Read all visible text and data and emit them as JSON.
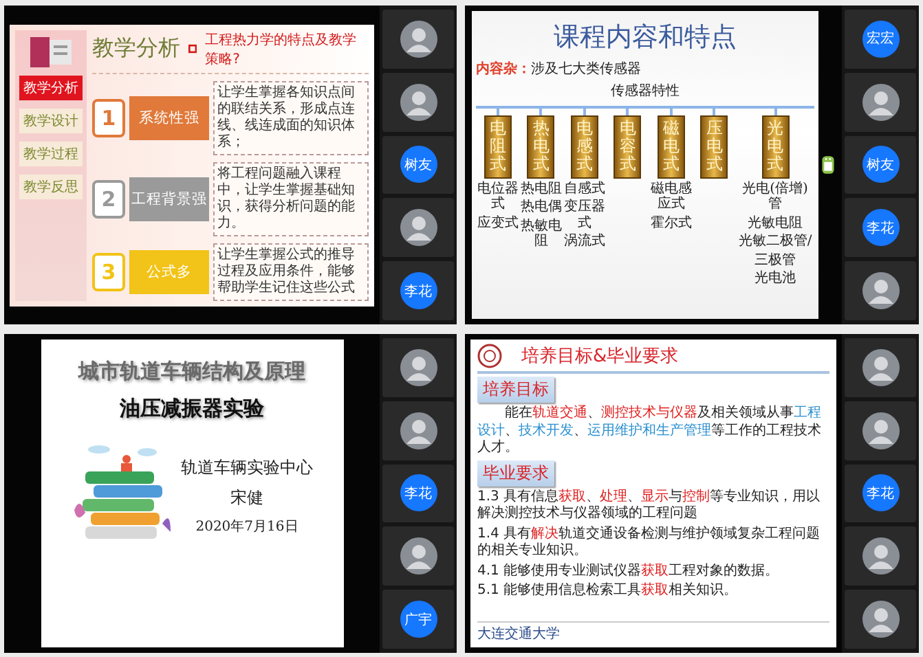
{
  "panels": [
    {
      "kind": "analysis",
      "slide": {
        "title": "教学分析",
        "question": "工程热力学的特点及教学策略?",
        "nav": [
          {
            "label": "教学分析",
            "selected": true
          },
          {
            "label": "教学设计",
            "selected": false
          },
          {
            "label": "教学过程",
            "selected": false
          },
          {
            "label": "教学反思",
            "selected": false
          }
        ],
        "items": [
          {
            "number": "1",
            "label": "系统性强",
            "color": "#e0793a",
            "text": "让学生掌握各知识点间的联结关系，形成点连线、线连成面的知识体系；"
          },
          {
            "number": "2",
            "label": "工程背景强",
            "color": "#9a9a9a",
            "text": "将工程问题融入课程中，让学生掌握基础知识，获得分析问题的能力。"
          },
          {
            "number": "3",
            "label": "公式多",
            "color": "#f2c318",
            "text": "让学生掌握公式的推导过程及应用条件，能够帮助学生记住这些公式"
          }
        ]
      },
      "participants": [
        {
          "kind": "photo"
        },
        {
          "kind": "photo"
        },
        {
          "kind": "initials",
          "name": "树友"
        },
        {
          "kind": "photo"
        },
        {
          "kind": "initials",
          "name": "李花"
        }
      ]
    },
    {
      "kind": "sensors",
      "slide": {
        "title": "课程内容和特点",
        "content_label": "内容杂：",
        "content_text": "涉及七大类传感器",
        "root": "传感器特性",
        "columns": [
          {
            "label": "电阻式",
            "examples": [
              "电位器式",
              "应变式"
            ]
          },
          {
            "label": "热电式",
            "examples": [
              "热电阻",
              "热电偶",
              "热敏电阻"
            ]
          },
          {
            "label": "电感式",
            "examples": [
              "自感式",
              "变压器式",
              "涡流式"
            ]
          },
          {
            "label": "电容式"
          },
          {
            "label": "磁电式",
            "examples": [
              "磁电感应式",
              "霍尔式"
            ]
          },
          {
            "label": "压电式"
          },
          {
            "label": "光电式",
            "examples": [
              "光电(倍增)管",
              "光敏电阻",
              "光敏二极管/",
              "三极管",
              "光电池"
            ]
          }
        ]
      },
      "participants": [
        {
          "kind": "initials",
          "name": "宏宏"
        },
        {
          "kind": "photo"
        },
        {
          "kind": "initials",
          "name": "树友"
        },
        {
          "kind": "initials",
          "name": "李花"
        },
        {
          "kind": "photo"
        }
      ]
    },
    {
      "kind": "cover",
      "slide": {
        "title": "城市轨道车辆结构及原理",
        "subtitle": "油压减振器实验",
        "organization": "轨道车辆实验中心",
        "presenter": "宋健",
        "date": "2020年7月16日"
      },
      "participants": [
        {
          "kind": "photo"
        },
        {
          "kind": "photo"
        },
        {
          "kind": "initials",
          "name": "李花"
        },
        {
          "kind": "photo"
        },
        {
          "kind": "initials",
          "name": "广宇"
        }
      ]
    },
    {
      "kind": "requirements",
      "slide": {
        "title": "培养目标&毕业要求",
        "footer": "大连交通大学",
        "sections": [
          {
            "heading": "培养目标",
            "indent": true,
            "paragraphs": [
              [
                {
                  "text": "能在",
                  "kind": "plain"
                },
                {
                  "text": "轨道交通",
                  "kind": "red"
                },
                {
                  "text": "、",
                  "kind": "plain"
                },
                {
                  "text": "测控技术与仪器",
                  "kind": "red"
                },
                {
                  "text": "及相关领域从事",
                  "kind": "plain"
                },
                {
                  "text": "工程设计",
                  "kind": "blue"
                },
                {
                  "text": "、",
                  "kind": "plain"
                },
                {
                  "text": "技术开发",
                  "kind": "blue"
                },
                {
                  "text": "、",
                  "kind": "plain"
                },
                {
                  "text": "运用维护和生产管理",
                  "kind": "blue"
                },
                {
                  "text": "等工作的工程技术人才。",
                  "kind": "plain"
                }
              ]
            ]
          },
          {
            "heading": "毕业要求",
            "indent": false,
            "paragraphs": [
              [
                {
                  "text": "1.3 具有信息",
                  "kind": "plain"
                },
                {
                  "text": "获取",
                  "kind": "red"
                },
                {
                  "text": "、",
                  "kind": "plain"
                },
                {
                  "text": "处理",
                  "kind": "red"
                },
                {
                  "text": "、",
                  "kind": "plain"
                },
                {
                  "text": "显示",
                  "kind": "red"
                },
                {
                  "text": "与",
                  "kind": "plain"
                },
                {
                  "text": "控制",
                  "kind": "red"
                },
                {
                  "text": "等专业知识，用以解决测控技术与仪器领域的工程问题",
                  "kind": "plain"
                }
              ],
              [
                {
                  "text": "1.4 具有",
                  "kind": "plain"
                },
                {
                  "text": "解决",
                  "kind": "red"
                },
                {
                  "text": "轨道交通设备检测与维护领域复杂工程问题的相关专业知识。",
                  "kind": "plain"
                }
              ],
              [
                {
                  "text": "4.1 能够使用专业测试仪器",
                  "kind": "plain"
                },
                {
                  "text": "获取",
                  "kind": "red"
                },
                {
                  "text": "工程对象的数据。",
                  "kind": "plain"
                }
              ],
              [
                {
                  "text": "5.1 能够使用信息检索工具",
                  "kind": "plain"
                },
                {
                  "text": "获取",
                  "kind": "red"
                },
                {
                  "text": "相关知识。",
                  "kind": "plain"
                }
              ]
            ]
          }
        ]
      },
      "participants": [
        {
          "kind": "photo"
        },
        {
          "kind": "photo"
        },
        {
          "kind": "initials",
          "name": "李花"
        },
        {
          "kind": "photo"
        },
        {
          "kind": "photo"
        }
      ]
    }
  ]
}
